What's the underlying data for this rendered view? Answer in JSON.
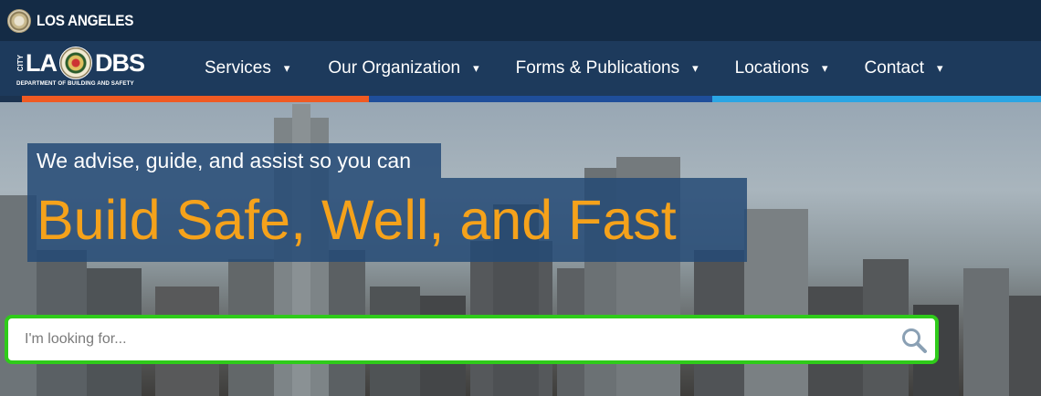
{
  "topbar": {
    "city_name": "LOS ANGELES"
  },
  "logo": {
    "city": "CITY",
    "left": "LA",
    "right": "DBS",
    "subtitle": "DEPARTMENT OF BUILDING AND SAFETY"
  },
  "nav": {
    "items": [
      {
        "label": "Services",
        "caret": "▾"
      },
      {
        "label": "Our Organization",
        "caret": "▾"
      },
      {
        "label": "Forms & Publications",
        "caret": "▾"
      },
      {
        "label": "Locations",
        "caret": "▾"
      },
      {
        "label": "Contact",
        "caret": "▾"
      }
    ]
  },
  "hero": {
    "tagline": "We advise, guide, and assist so you can",
    "headline": "Build Safe, Well, and Fast"
  },
  "search": {
    "placeholder": "I'm looking for...",
    "icon": "search-icon"
  },
  "colors": {
    "accent_orange": "#f05a22",
    "accent_blue": "#1f4e9a",
    "accent_light_blue": "#2aa5e4",
    "headline": "#f5a21b",
    "search_border": "#2fcb1a"
  }
}
